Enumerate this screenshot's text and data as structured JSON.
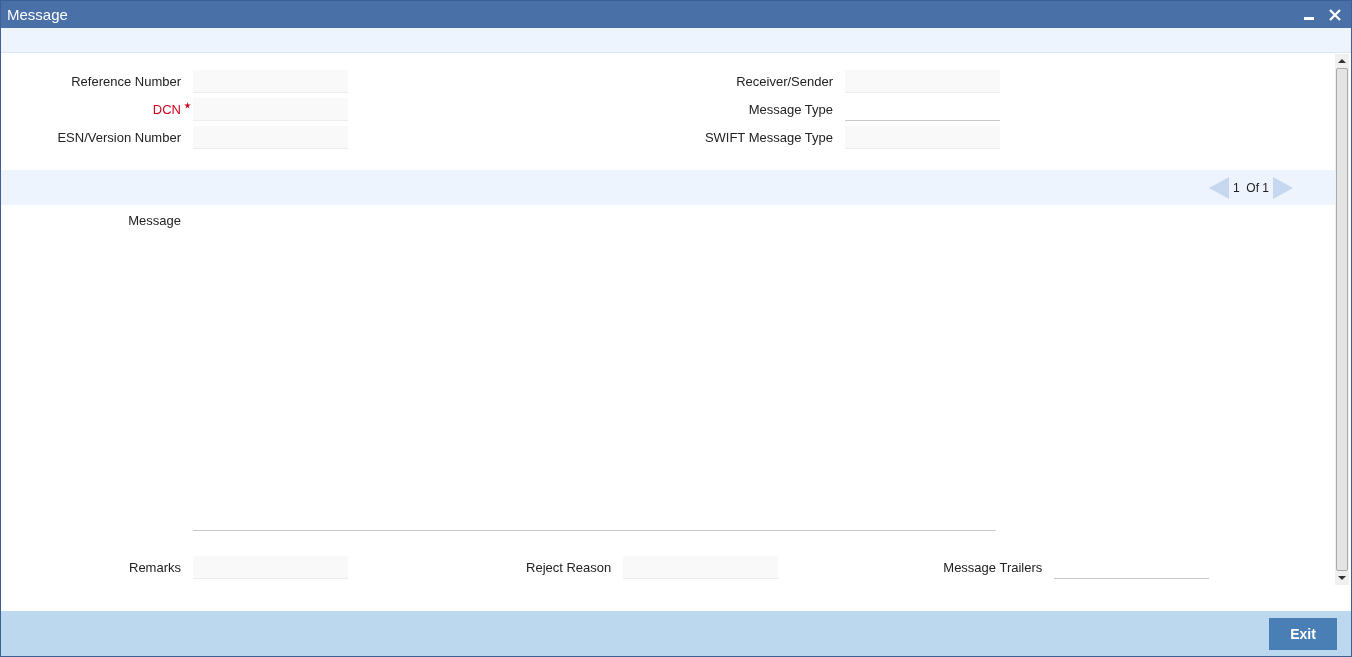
{
  "window": {
    "title": "Message"
  },
  "header_fields_left": [
    {
      "label": "Reference Number",
      "required": false,
      "readonly": true
    },
    {
      "label": "DCN",
      "required": true,
      "readonly": true
    },
    {
      "label": "ESN/Version Number",
      "required": false,
      "readonly": true
    }
  ],
  "header_fields_right": [
    {
      "label": "Receiver/Sender",
      "required": false,
      "readonly": true
    },
    {
      "label": "Message Type",
      "required": false,
      "readonly": false
    },
    {
      "label": "SWIFT Message Type",
      "required": false,
      "readonly": true
    }
  ],
  "pager": {
    "current": "1",
    "separator": "Of",
    "total": "1"
  },
  "message": {
    "label": "Message"
  },
  "footer_fields": [
    {
      "label": "Remarks",
      "readonly": true
    },
    {
      "label": "Reject Reason",
      "readonly": true
    },
    {
      "label": "Message Trailers",
      "readonly": false
    }
  ],
  "buttons": [
    "Exit"
  ]
}
